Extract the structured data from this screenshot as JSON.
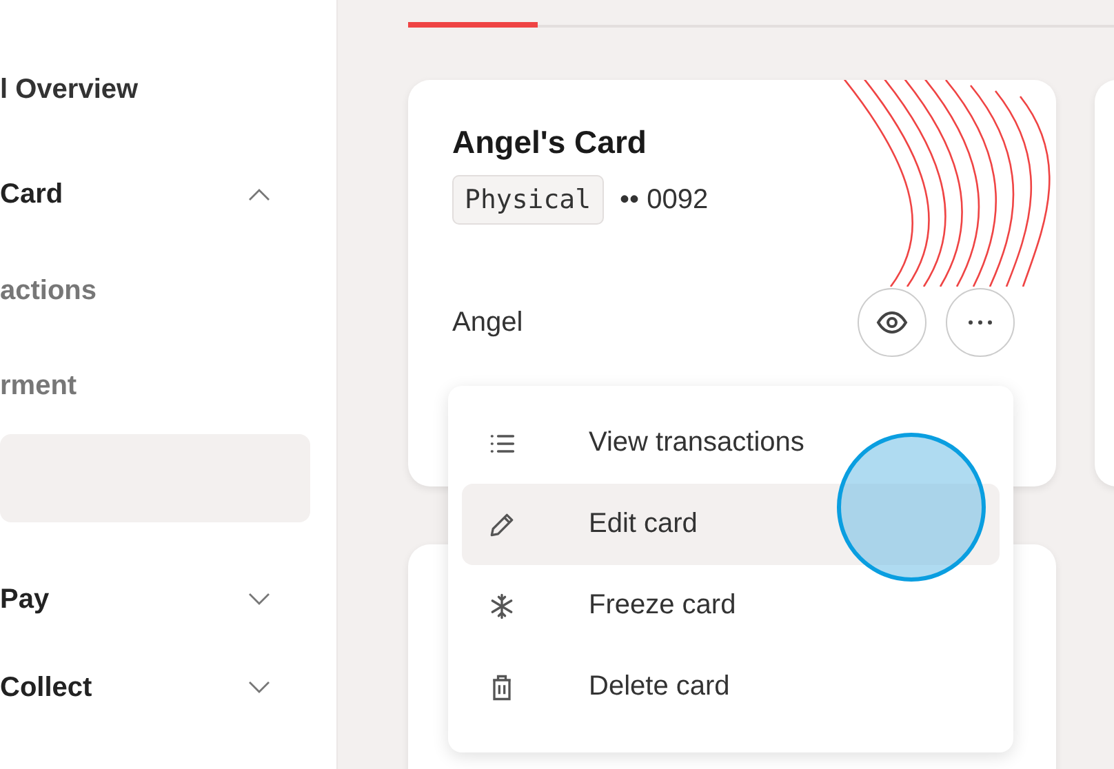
{
  "sidebar": {
    "items": [
      {
        "kind": "link",
        "label": "l Overview"
      },
      {
        "kind": "group",
        "label": "Card",
        "expanded": true,
        "children": [
          {
            "label": "actions",
            "selected": false
          },
          {
            "label": "rment",
            "selected": false
          },
          {
            "selected": true
          }
        ]
      },
      {
        "kind": "group",
        "label": "Pay",
        "expanded": false
      },
      {
        "kind": "group",
        "label": "Collect",
        "expanded": false
      }
    ]
  },
  "tabs": [
    {
      "selected": true
    },
    {
      "selected": false
    }
  ],
  "card": {
    "title": "Angel's Card",
    "type_badge": "Physical",
    "number": "•• 0092",
    "holder": "Angel"
  },
  "menu": {
    "items": [
      {
        "kind": "list",
        "label": "View transactions",
        "selected": false
      },
      {
        "kind": "pencil",
        "label": "Edit card",
        "selected": true
      },
      {
        "kind": "snowflake",
        "label": "Freeze card",
        "selected": false
      },
      {
        "kind": "trash",
        "label": "Delete card",
        "selected": false
      }
    ]
  }
}
